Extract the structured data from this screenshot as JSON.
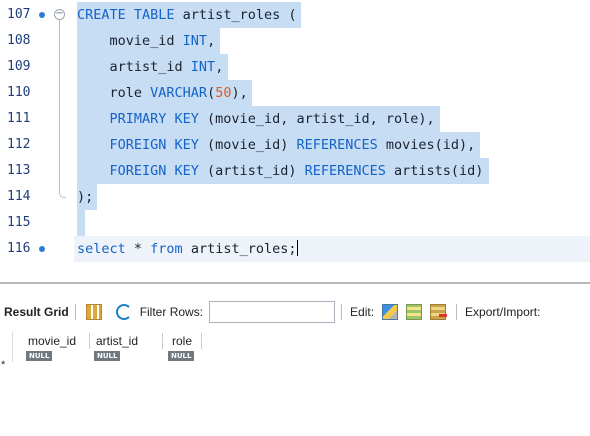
{
  "editor": {
    "lines": [
      {
        "num": "107",
        "has_dot": true,
        "fold": "open",
        "tokens": [
          {
            "t": "CREATE TABLE",
            "c": "kw"
          },
          {
            "t": " artist_roles (",
            "c": ""
          }
        ]
      },
      {
        "num": "108",
        "has_dot": false,
        "fold": "line",
        "tokens": [
          {
            "t": "    movie_id ",
            "c": ""
          },
          {
            "t": "INT",
            "c": "kw"
          },
          {
            "t": ",",
            "c": ""
          }
        ]
      },
      {
        "num": "109",
        "has_dot": false,
        "fold": "line",
        "tokens": [
          {
            "t": "    artist_id ",
            "c": ""
          },
          {
            "t": "INT",
            "c": "kw"
          },
          {
            "t": ",",
            "c": ""
          }
        ]
      },
      {
        "num": "110",
        "has_dot": false,
        "fold": "line",
        "tokens": [
          {
            "t": "    role ",
            "c": ""
          },
          {
            "t": "VARCHAR",
            "c": "kw"
          },
          {
            "t": "(",
            "c": ""
          },
          {
            "t": "50",
            "c": "num"
          },
          {
            "t": "),",
            "c": ""
          }
        ]
      },
      {
        "num": "111",
        "has_dot": false,
        "fold": "line",
        "tokens": [
          {
            "t": "    ",
            "c": ""
          },
          {
            "t": "PRIMARY KEY",
            "c": "kw"
          },
          {
            "t": " (movie_id, artist_id, role),",
            "c": ""
          }
        ]
      },
      {
        "num": "112",
        "has_dot": false,
        "fold": "line",
        "tokens": [
          {
            "t": "    ",
            "c": ""
          },
          {
            "t": "FOREIGN KEY",
            "c": "kw"
          },
          {
            "t": " (movie_id) ",
            "c": ""
          },
          {
            "t": "REFERENCES",
            "c": "kw"
          },
          {
            "t": " movies(id),",
            "c": ""
          }
        ]
      },
      {
        "num": "113",
        "has_dot": false,
        "fold": "line",
        "tokens": [
          {
            "t": "    ",
            "c": ""
          },
          {
            "t": "FOREIGN KEY",
            "c": "kw"
          },
          {
            "t": " (artist_id) ",
            "c": ""
          },
          {
            "t": "REFERENCES",
            "c": "kw"
          },
          {
            "t": " artists(id)",
            "c": ""
          }
        ]
      },
      {
        "num": "114",
        "has_dot": false,
        "fold": "end",
        "tokens": [
          {
            "t": ");",
            "c": ""
          }
        ]
      },
      {
        "num": "115",
        "has_dot": false,
        "fold": "none",
        "tokens": []
      },
      {
        "num": "116",
        "has_dot": true,
        "fold": "none",
        "current": true,
        "tokens": [
          {
            "t": "select",
            "c": "kw"
          },
          {
            "t": " * ",
            "c": ""
          },
          {
            "t": "from",
            "c": "kw"
          },
          {
            "t": " artist_roles;",
            "c": ""
          }
        ]
      }
    ]
  },
  "result_toolbar": {
    "result_grid_label": "Result Grid",
    "filter_rows_label": "Filter Rows:",
    "filter_value": "",
    "edit_label": "Edit:",
    "export_label": "Export/Import:"
  },
  "result_grid": {
    "columns": [
      "movie_id",
      "artist_id",
      "role"
    ],
    "new_row_marker": "*",
    "null_label": "NULL"
  },
  "colors": {
    "selection": "#c7ddf4",
    "keyword": "#1463c8",
    "number": "#e0591d"
  }
}
